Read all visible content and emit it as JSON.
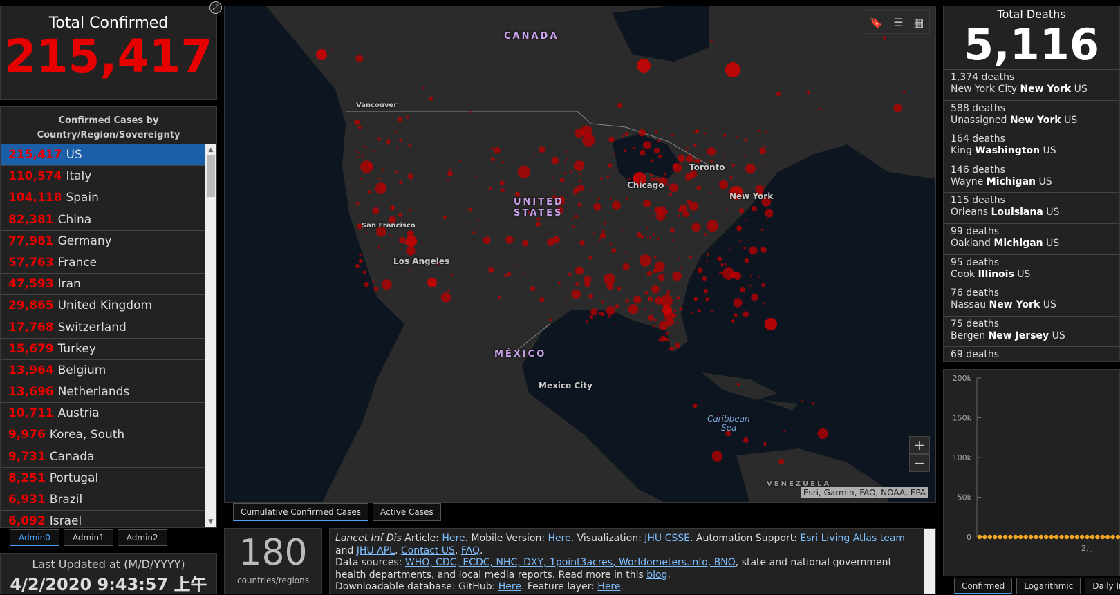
{
  "total_confirmed": {
    "title": "Total Confirmed",
    "value": "215,417"
  },
  "country_list": {
    "header_line1": "Confirmed Cases by",
    "header_line2": "Country/Region/Sovereignty",
    "rows": [
      {
        "count": "215,417",
        "name": "US",
        "selected": true
      },
      {
        "count": "110,574",
        "name": "Italy"
      },
      {
        "count": "104,118",
        "name": "Spain"
      },
      {
        "count": "82,381",
        "name": "China"
      },
      {
        "count": "77,981",
        "name": "Germany"
      },
      {
        "count": "57,763",
        "name": "France"
      },
      {
        "count": "47,593",
        "name": "Iran"
      },
      {
        "count": "29,865",
        "name": "United Kingdom"
      },
      {
        "count": "17,768",
        "name": "Switzerland"
      },
      {
        "count": "15,679",
        "name": "Turkey"
      },
      {
        "count": "13,964",
        "name": "Belgium"
      },
      {
        "count": "13,696",
        "name": "Netherlands"
      },
      {
        "count": "10,711",
        "name": "Austria"
      },
      {
        "count": "9,976",
        "name": "Korea, South"
      },
      {
        "count": "9,731",
        "name": "Canada"
      },
      {
        "count": "8,251",
        "name": "Portugal"
      },
      {
        "count": "6,931",
        "name": "Brazil"
      },
      {
        "count": "6,092",
        "name": "Israel"
      }
    ]
  },
  "admin_tabs": [
    "Admin0",
    "Admin1",
    "Admin2"
  ],
  "last_updated": {
    "label": "Last Updated at (M/D/YYYY)",
    "value": "4/2/2020 9:43:57 上午"
  },
  "map": {
    "labels": {
      "canada": "CANADA",
      "united": "UNITED",
      "states": "STATES",
      "mexico": "MÉXICO",
      "vancouver": "Vancouver",
      "toronto": "Toronto",
      "chicago": "Chicago",
      "new_york": "New York",
      "san_francisco": "San Francisco",
      "los_angeles": "Los Angeles",
      "mexico_city": "Mexico City",
      "caribbean": "Caribbean",
      "sea": "Sea",
      "venezuela": "VENEZUELA"
    },
    "attribution": "Esri, Garmin, FAO, NOAA, EPA",
    "zoom_in": "+",
    "zoom_out": "−",
    "tools": {
      "bookmark": "🔖",
      "list": "☰",
      "qr": "▦"
    }
  },
  "map_tabs": [
    "Cumulative Confirmed Cases",
    "Active Cases"
  ],
  "countries_count": {
    "value": "180",
    "label": "countries/regions"
  },
  "info": {
    "article_prefix": "Lancet Inf Dis",
    "article_word": " Article: ",
    "here": "Here",
    "mobile": ". Mobile Version: ",
    "viz": ". Visualization: ",
    "jhu_csse": "JHU CSSE",
    "automation": ". Automation Support: ",
    "esri_team": "Esri Living Atlas team",
    "and": " and ",
    "jhu_apl": "JHU APL",
    "dot": ". ",
    "contact": "Contact US",
    "faq": "FAQ",
    "end_dot": ".",
    "data_sources": "Data sources: ",
    "sources_links": "WHO, CDC, ECDC, NHC, DXY, 1point3acres, Worldometers.info, BNO",
    "sources_rest": ", state and national government health departments, and local media reports.  Read more in this ",
    "blog": "blog",
    "download": "Downloadable database: GitHub: ",
    "feature": ". Feature layer: "
  },
  "total_deaths": {
    "title": "Total Deaths",
    "value": "5,116",
    "rows": [
      {
        "deaths": "1,374 deaths",
        "area": "New York City",
        "state": "New York",
        "country": "US"
      },
      {
        "deaths": "588 deaths",
        "area": "Unassigned",
        "state": "New York",
        "country": "US"
      },
      {
        "deaths": "164 deaths",
        "area": "King",
        "state": "Washington",
        "country": "US"
      },
      {
        "deaths": "146 deaths",
        "area": "Wayne",
        "state": "Michigan",
        "country": "US"
      },
      {
        "deaths": "115 deaths",
        "area": "Orleans",
        "state": "Louisiana",
        "country": "US"
      },
      {
        "deaths": "99 deaths",
        "area": "Oakland",
        "state": "Michigan",
        "country": "US"
      },
      {
        "deaths": "95 deaths",
        "area": "Cook",
        "state": "Illinois",
        "country": "US"
      },
      {
        "deaths": "76 deaths",
        "area": "Nassau",
        "state": "New York",
        "country": "US"
      },
      {
        "deaths": "75 deaths",
        "area": "Bergen",
        "state": "New Jersey",
        "country": "US"
      },
      {
        "deaths": "69 deaths",
        "area": "",
        "state": "",
        "country": ""
      }
    ]
  },
  "chart_tabs": [
    "Confirmed",
    "Logarithmic",
    "Daily In"
  ],
  "chart_data": {
    "type": "line",
    "title": "",
    "y_ticks": [
      "0",
      "50k",
      "100k",
      "150k",
      "200k"
    ],
    "ylim": [
      0,
      200000
    ],
    "x_tick": "2月",
    "series": [
      {
        "values": [
          0,
          0,
          0,
          0,
          0,
          0,
          0,
          0,
          0,
          0,
          0,
          0,
          0,
          0,
          0,
          0,
          0,
          0,
          0,
          0,
          0,
          0,
          0,
          0,
          0,
          0,
          0,
          0
        ]
      }
    ],
    "color": "#f5a623"
  }
}
